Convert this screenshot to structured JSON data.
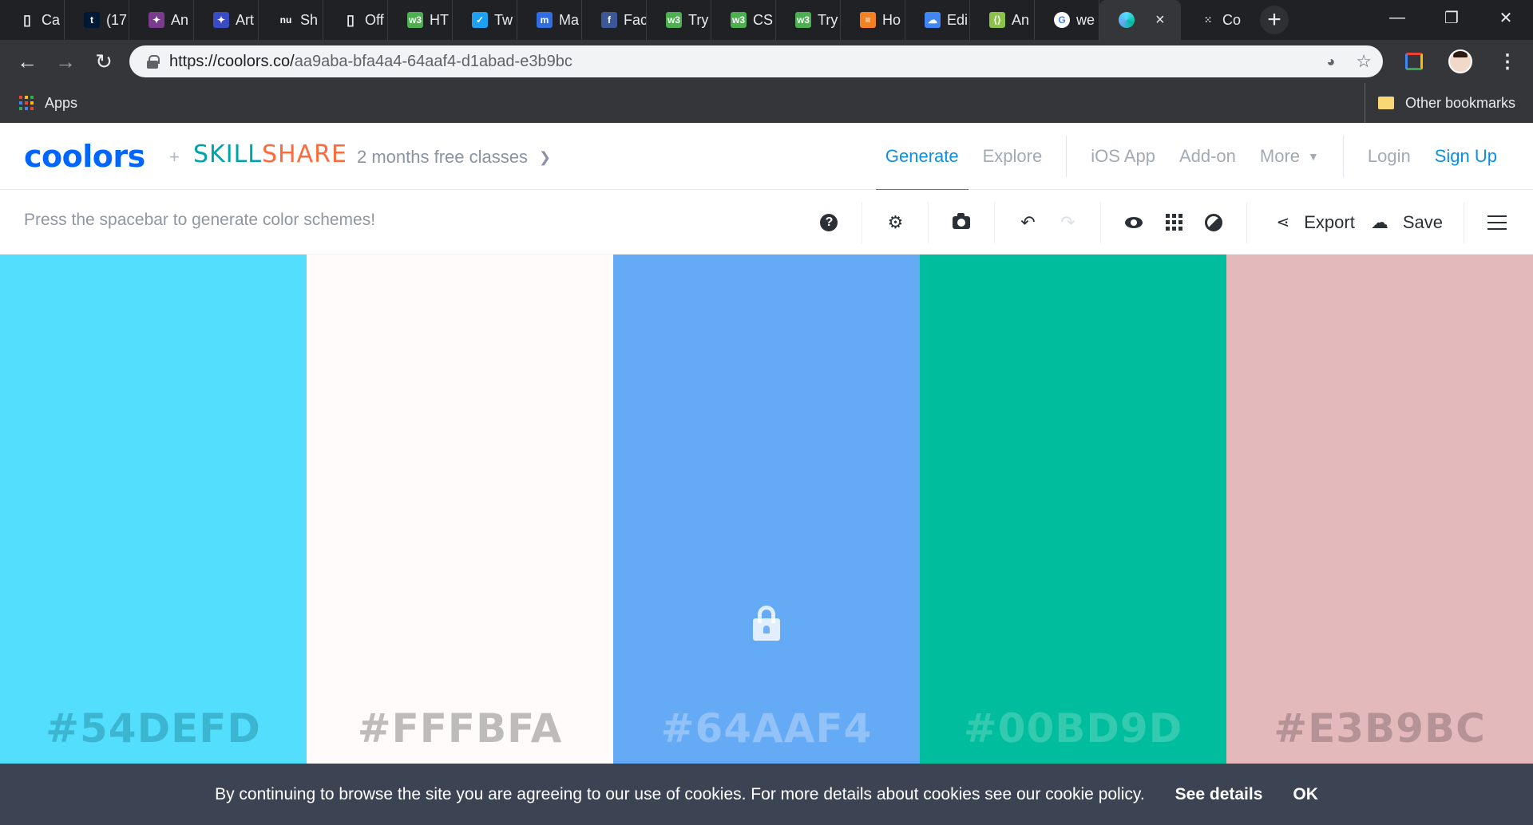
{
  "browser": {
    "tabs": [
      {
        "title": "Ca",
        "icon": "doc-icon",
        "color": "#e8eaed"
      },
      {
        "title": "(17",
        "icon": "tumblr-icon",
        "color": "#001935"
      },
      {
        "title": "An",
        "icon": "art-icon",
        "color": "#7a3b8f"
      },
      {
        "title": "Art",
        "icon": "art-icon",
        "color": "#3a4cc4"
      },
      {
        "title": "Sh",
        "icon": "nu-icon",
        "color": "#202124"
      },
      {
        "title": "Off",
        "icon": "doc-icon",
        "color": "#e8eaed"
      },
      {
        "title": "HT",
        "icon": "w3schools-icon",
        "color": "#4caf50"
      },
      {
        "title": "Tw",
        "icon": "twitter-icon",
        "color": "#1da1f2"
      },
      {
        "title": "Ma",
        "icon": "m-icon",
        "color": "#2f6de0"
      },
      {
        "title": "Fac",
        "icon": "facebook-icon",
        "color": "#3b5998"
      },
      {
        "title": "Try",
        "icon": "w3schools-icon",
        "color": "#4caf50"
      },
      {
        "title": "CS",
        "icon": "w3schools-icon",
        "color": "#4caf50"
      },
      {
        "title": "Try",
        "icon": "w3schools-icon",
        "color": "#4caf50"
      },
      {
        "title": "Ho",
        "icon": "stack-icon",
        "color": "#f48024"
      },
      {
        "title": "Edi",
        "icon": "cloud-icon",
        "color": "#4285f4"
      },
      {
        "title": "An",
        "icon": "code-icon",
        "color": "#8bc34a"
      },
      {
        "title": "we",
        "icon": "google-icon",
        "color": "#ffffff"
      }
    ],
    "active_tab": {
      "icon": "coolors-icon",
      "close": "×"
    },
    "after_tab": {
      "title": "Co",
      "icon": "dots-icon"
    },
    "new_tab": "+",
    "window_controls": {
      "minimize": "—",
      "restore": "❐",
      "close": "✕"
    },
    "url_host": "https://coolors.co/",
    "url_path": "aa9aba-bfa4a4-64aaf4-d1abad-e3b9bc",
    "bookmarks": {
      "apps": "Apps",
      "other": "Other bookmarks"
    }
  },
  "site": {
    "logo": "coolors",
    "plus": "+",
    "partner": {
      "part1": "SKILL",
      "part2": "SHARE"
    },
    "promo": "2 months free classes",
    "nav": {
      "generate": "Generate",
      "explore": "Explore",
      "ios": "iOS App",
      "addon": "Add-on",
      "more": "More",
      "login": "Login",
      "signup": "Sign Up"
    }
  },
  "toolbar": {
    "hint": "Press the spacebar to generate color schemes!",
    "export": "Export",
    "save": "Save"
  },
  "palette": [
    {
      "hex": "#54DEFD",
      "bg": "#54DEFD",
      "text_color": "#2a95ad",
      "locked": false
    },
    {
      "hex": "#FFFBFA",
      "bg": "#FFFBFA",
      "text_color": "#8a8888",
      "locked": false
    },
    {
      "hex": "#64AAF4",
      "bg": "#64AAF4",
      "text_color": "#b8d6fb",
      "locked": true
    },
    {
      "hex": "#00BD9D",
      "bg": "#00BD9D",
      "text_color": "#5ed6c0",
      "locked": false
    },
    {
      "hex": "#E3B9BC",
      "bg": "#E3B9BC",
      "text_color": "#8f7476",
      "locked": false
    }
  ],
  "cookie": {
    "message": "By continuing to browse the site you are agreeing to our use of cookies. For more details about cookies see our cookie policy.",
    "details": "See details",
    "ok": "OK"
  }
}
